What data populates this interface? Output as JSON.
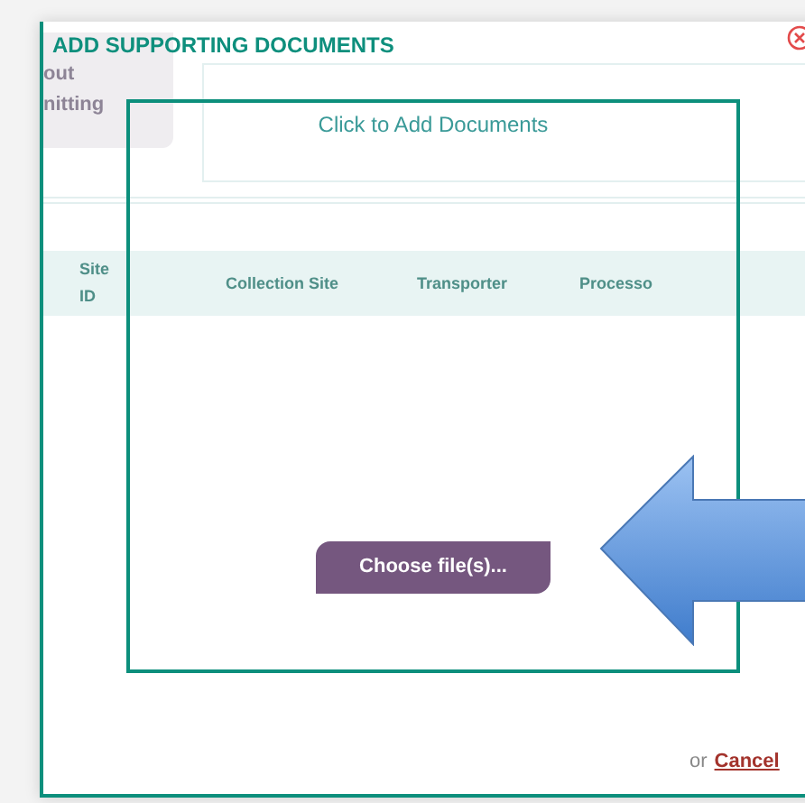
{
  "background": {
    "button_lines": [
      "out",
      "nitting"
    ],
    "table_columns": [
      "Site ID",
      "Collection Site",
      "Transporter",
      "Processo"
    ]
  },
  "dialog": {
    "title": "ADD SUPPORTING DOCUMENTS",
    "drop_zone": {
      "label": "Click to Add Documents",
      "button": "Choose file(s)..."
    },
    "footer": {
      "prefix": "or",
      "cancel": "Cancel"
    }
  }
}
